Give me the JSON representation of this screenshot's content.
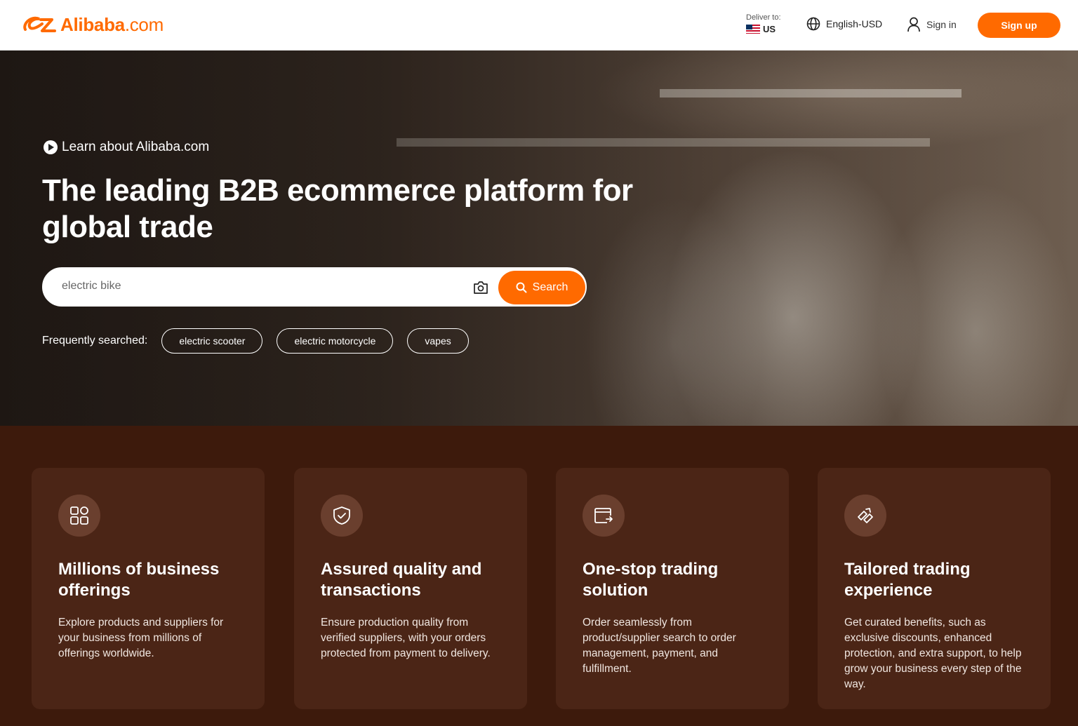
{
  "header": {
    "logo": {
      "brand": "Alibaba",
      "suffix": ".com"
    },
    "deliver_label": "Deliver to:",
    "deliver_country": "US",
    "language": "English-USD",
    "sign_in": "Sign in",
    "sign_up": "Sign up"
  },
  "hero": {
    "learn_link": "Learn about Alibaba.com",
    "title": "The leading B2B ecommerce platform for global trade",
    "search": {
      "placeholder": "electric bike",
      "button": "Search"
    },
    "frequent_label": "Frequently searched:",
    "frequent": [
      "electric scooter",
      "electric motorcycle",
      "vapes"
    ]
  },
  "features": [
    {
      "icon": "grid-icon",
      "title": "Millions of business offerings",
      "text": "Explore products and suppliers for your business from millions of offerings worldwide."
    },
    {
      "icon": "shield-check-icon",
      "title": "Assured quality and transactions",
      "text": "Ensure production quality from verified suppliers, with your orders protected from payment to delivery."
    },
    {
      "icon": "card-transfer-icon",
      "title": "One-stop trading solution",
      "text": "Order seamlessly from product/supplier search to order management, payment, and fulfillment."
    },
    {
      "icon": "tailored-icon",
      "title": "Tailored trading experience",
      "text": "Get curated benefits, such as exclusive discounts, enhanced protection, and extra support, to help grow your business every step of the way."
    }
  ],
  "colors": {
    "brand": "#ff6a00",
    "features_bg": "#3d1a0c",
    "card_bg": "#4b2516"
  }
}
